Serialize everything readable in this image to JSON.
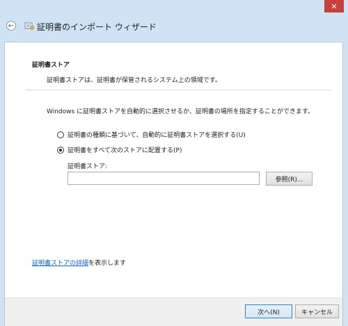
{
  "window": {
    "title": "証明書のインポート ウィザード",
    "close_glyph": "✕",
    "back_glyph": "←"
  },
  "header": {
    "title": "証明書ストア",
    "description": "証明書ストアは、証明書が保管されるシステム上の領域です。"
  },
  "main": {
    "intro": "Windows に証明書ストアを自動的に選択させるか、証明書の場所を指定することができます。",
    "options": [
      {
        "label": "証明書の種類に基づいて、自動的に証明書ストアを選択する(U)",
        "selected": false
      },
      {
        "label": "証明書をすべて次のストアに配置する(P)",
        "selected": true
      }
    ],
    "store_label": "証明書ストア:",
    "store_value": "",
    "browse_label": "参照(R)..."
  },
  "link": {
    "text": "証明書ストアの詳細",
    "suffix": "を表示します"
  },
  "footer": {
    "next_label": "次へ(N)",
    "cancel_label": "キャンセル"
  },
  "colors": {
    "frame": "#cfe3f5",
    "close": "#c7413c",
    "link": "#0066cc"
  }
}
